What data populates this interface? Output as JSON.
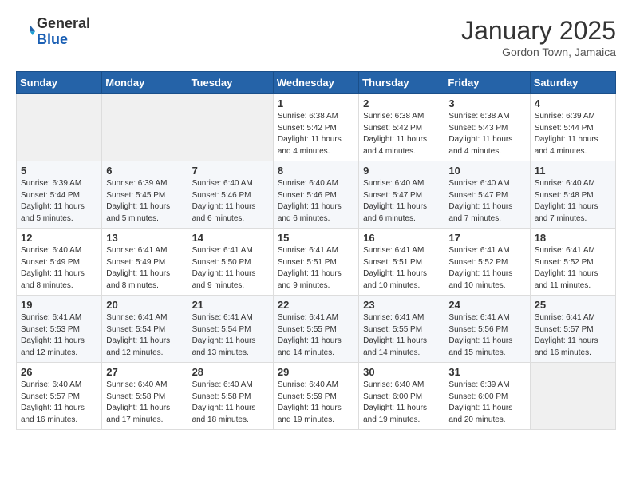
{
  "header": {
    "logo_general": "General",
    "logo_blue": "Blue",
    "month_title": "January 2025",
    "subtitle": "Gordon Town, Jamaica"
  },
  "weekdays": [
    "Sunday",
    "Monday",
    "Tuesday",
    "Wednesday",
    "Thursday",
    "Friday",
    "Saturday"
  ],
  "weeks": [
    [
      {
        "day": "",
        "sunrise": "",
        "sunset": "",
        "daylight": ""
      },
      {
        "day": "",
        "sunrise": "",
        "sunset": "",
        "daylight": ""
      },
      {
        "day": "",
        "sunrise": "",
        "sunset": "",
        "daylight": ""
      },
      {
        "day": "1",
        "sunrise": "Sunrise: 6:38 AM",
        "sunset": "Sunset: 5:42 PM",
        "daylight": "Daylight: 11 hours and 4 minutes."
      },
      {
        "day": "2",
        "sunrise": "Sunrise: 6:38 AM",
        "sunset": "Sunset: 5:42 PM",
        "daylight": "Daylight: 11 hours and 4 minutes."
      },
      {
        "day": "3",
        "sunrise": "Sunrise: 6:38 AM",
        "sunset": "Sunset: 5:43 PM",
        "daylight": "Daylight: 11 hours and 4 minutes."
      },
      {
        "day": "4",
        "sunrise": "Sunrise: 6:39 AM",
        "sunset": "Sunset: 5:44 PM",
        "daylight": "Daylight: 11 hours and 4 minutes."
      }
    ],
    [
      {
        "day": "5",
        "sunrise": "Sunrise: 6:39 AM",
        "sunset": "Sunset: 5:44 PM",
        "daylight": "Daylight: 11 hours and 5 minutes."
      },
      {
        "day": "6",
        "sunrise": "Sunrise: 6:39 AM",
        "sunset": "Sunset: 5:45 PM",
        "daylight": "Daylight: 11 hours and 5 minutes."
      },
      {
        "day": "7",
        "sunrise": "Sunrise: 6:40 AM",
        "sunset": "Sunset: 5:46 PM",
        "daylight": "Daylight: 11 hours and 6 minutes."
      },
      {
        "day": "8",
        "sunrise": "Sunrise: 6:40 AM",
        "sunset": "Sunset: 5:46 PM",
        "daylight": "Daylight: 11 hours and 6 minutes."
      },
      {
        "day": "9",
        "sunrise": "Sunrise: 6:40 AM",
        "sunset": "Sunset: 5:47 PM",
        "daylight": "Daylight: 11 hours and 6 minutes."
      },
      {
        "day": "10",
        "sunrise": "Sunrise: 6:40 AM",
        "sunset": "Sunset: 5:47 PM",
        "daylight": "Daylight: 11 hours and 7 minutes."
      },
      {
        "day": "11",
        "sunrise": "Sunrise: 6:40 AM",
        "sunset": "Sunset: 5:48 PM",
        "daylight": "Daylight: 11 hours and 7 minutes."
      }
    ],
    [
      {
        "day": "12",
        "sunrise": "Sunrise: 6:40 AM",
        "sunset": "Sunset: 5:49 PM",
        "daylight": "Daylight: 11 hours and 8 minutes."
      },
      {
        "day": "13",
        "sunrise": "Sunrise: 6:41 AM",
        "sunset": "Sunset: 5:49 PM",
        "daylight": "Daylight: 11 hours and 8 minutes."
      },
      {
        "day": "14",
        "sunrise": "Sunrise: 6:41 AM",
        "sunset": "Sunset: 5:50 PM",
        "daylight": "Daylight: 11 hours and 9 minutes."
      },
      {
        "day": "15",
        "sunrise": "Sunrise: 6:41 AM",
        "sunset": "Sunset: 5:51 PM",
        "daylight": "Daylight: 11 hours and 9 minutes."
      },
      {
        "day": "16",
        "sunrise": "Sunrise: 6:41 AM",
        "sunset": "Sunset: 5:51 PM",
        "daylight": "Daylight: 11 hours and 10 minutes."
      },
      {
        "day": "17",
        "sunrise": "Sunrise: 6:41 AM",
        "sunset": "Sunset: 5:52 PM",
        "daylight": "Daylight: 11 hours and 10 minutes."
      },
      {
        "day": "18",
        "sunrise": "Sunrise: 6:41 AM",
        "sunset": "Sunset: 5:52 PM",
        "daylight": "Daylight: 11 hours and 11 minutes."
      }
    ],
    [
      {
        "day": "19",
        "sunrise": "Sunrise: 6:41 AM",
        "sunset": "Sunset: 5:53 PM",
        "daylight": "Daylight: 11 hours and 12 minutes."
      },
      {
        "day": "20",
        "sunrise": "Sunrise: 6:41 AM",
        "sunset": "Sunset: 5:54 PM",
        "daylight": "Daylight: 11 hours and 12 minutes."
      },
      {
        "day": "21",
        "sunrise": "Sunrise: 6:41 AM",
        "sunset": "Sunset: 5:54 PM",
        "daylight": "Daylight: 11 hours and 13 minutes."
      },
      {
        "day": "22",
        "sunrise": "Sunrise: 6:41 AM",
        "sunset": "Sunset: 5:55 PM",
        "daylight": "Daylight: 11 hours and 14 minutes."
      },
      {
        "day": "23",
        "sunrise": "Sunrise: 6:41 AM",
        "sunset": "Sunset: 5:55 PM",
        "daylight": "Daylight: 11 hours and 14 minutes."
      },
      {
        "day": "24",
        "sunrise": "Sunrise: 6:41 AM",
        "sunset": "Sunset: 5:56 PM",
        "daylight": "Daylight: 11 hours and 15 minutes."
      },
      {
        "day": "25",
        "sunrise": "Sunrise: 6:41 AM",
        "sunset": "Sunset: 5:57 PM",
        "daylight": "Daylight: 11 hours and 16 minutes."
      }
    ],
    [
      {
        "day": "26",
        "sunrise": "Sunrise: 6:40 AM",
        "sunset": "Sunset: 5:57 PM",
        "daylight": "Daylight: 11 hours and 16 minutes."
      },
      {
        "day": "27",
        "sunrise": "Sunrise: 6:40 AM",
        "sunset": "Sunset: 5:58 PM",
        "daylight": "Daylight: 11 hours and 17 minutes."
      },
      {
        "day": "28",
        "sunrise": "Sunrise: 6:40 AM",
        "sunset": "Sunset: 5:58 PM",
        "daylight": "Daylight: 11 hours and 18 minutes."
      },
      {
        "day": "29",
        "sunrise": "Sunrise: 6:40 AM",
        "sunset": "Sunset: 5:59 PM",
        "daylight": "Daylight: 11 hours and 19 minutes."
      },
      {
        "day": "30",
        "sunrise": "Sunrise: 6:40 AM",
        "sunset": "Sunset: 6:00 PM",
        "daylight": "Daylight: 11 hours and 19 minutes."
      },
      {
        "day": "31",
        "sunrise": "Sunrise: 6:39 AM",
        "sunset": "Sunset: 6:00 PM",
        "daylight": "Daylight: 11 hours and 20 minutes."
      },
      {
        "day": "",
        "sunrise": "",
        "sunset": "",
        "daylight": ""
      }
    ]
  ]
}
